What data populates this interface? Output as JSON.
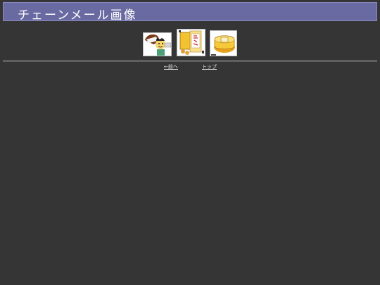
{
  "header": {
    "title": "チェーンメール画像"
  },
  "thumbnails": [
    {
      "icon": "cartoon-man-with-cup-icon"
    },
    {
      "icon": "vending-card-icon"
    },
    {
      "icon": "yellow-sticker-icon"
    }
  ],
  "nav": {
    "prev_label": "←前へ",
    "top_label": "トップ"
  },
  "colors": {
    "background": "#353535",
    "title_bar": "#6a6aa2",
    "title_text": "#ffffff",
    "link": "#e8e8e8"
  }
}
